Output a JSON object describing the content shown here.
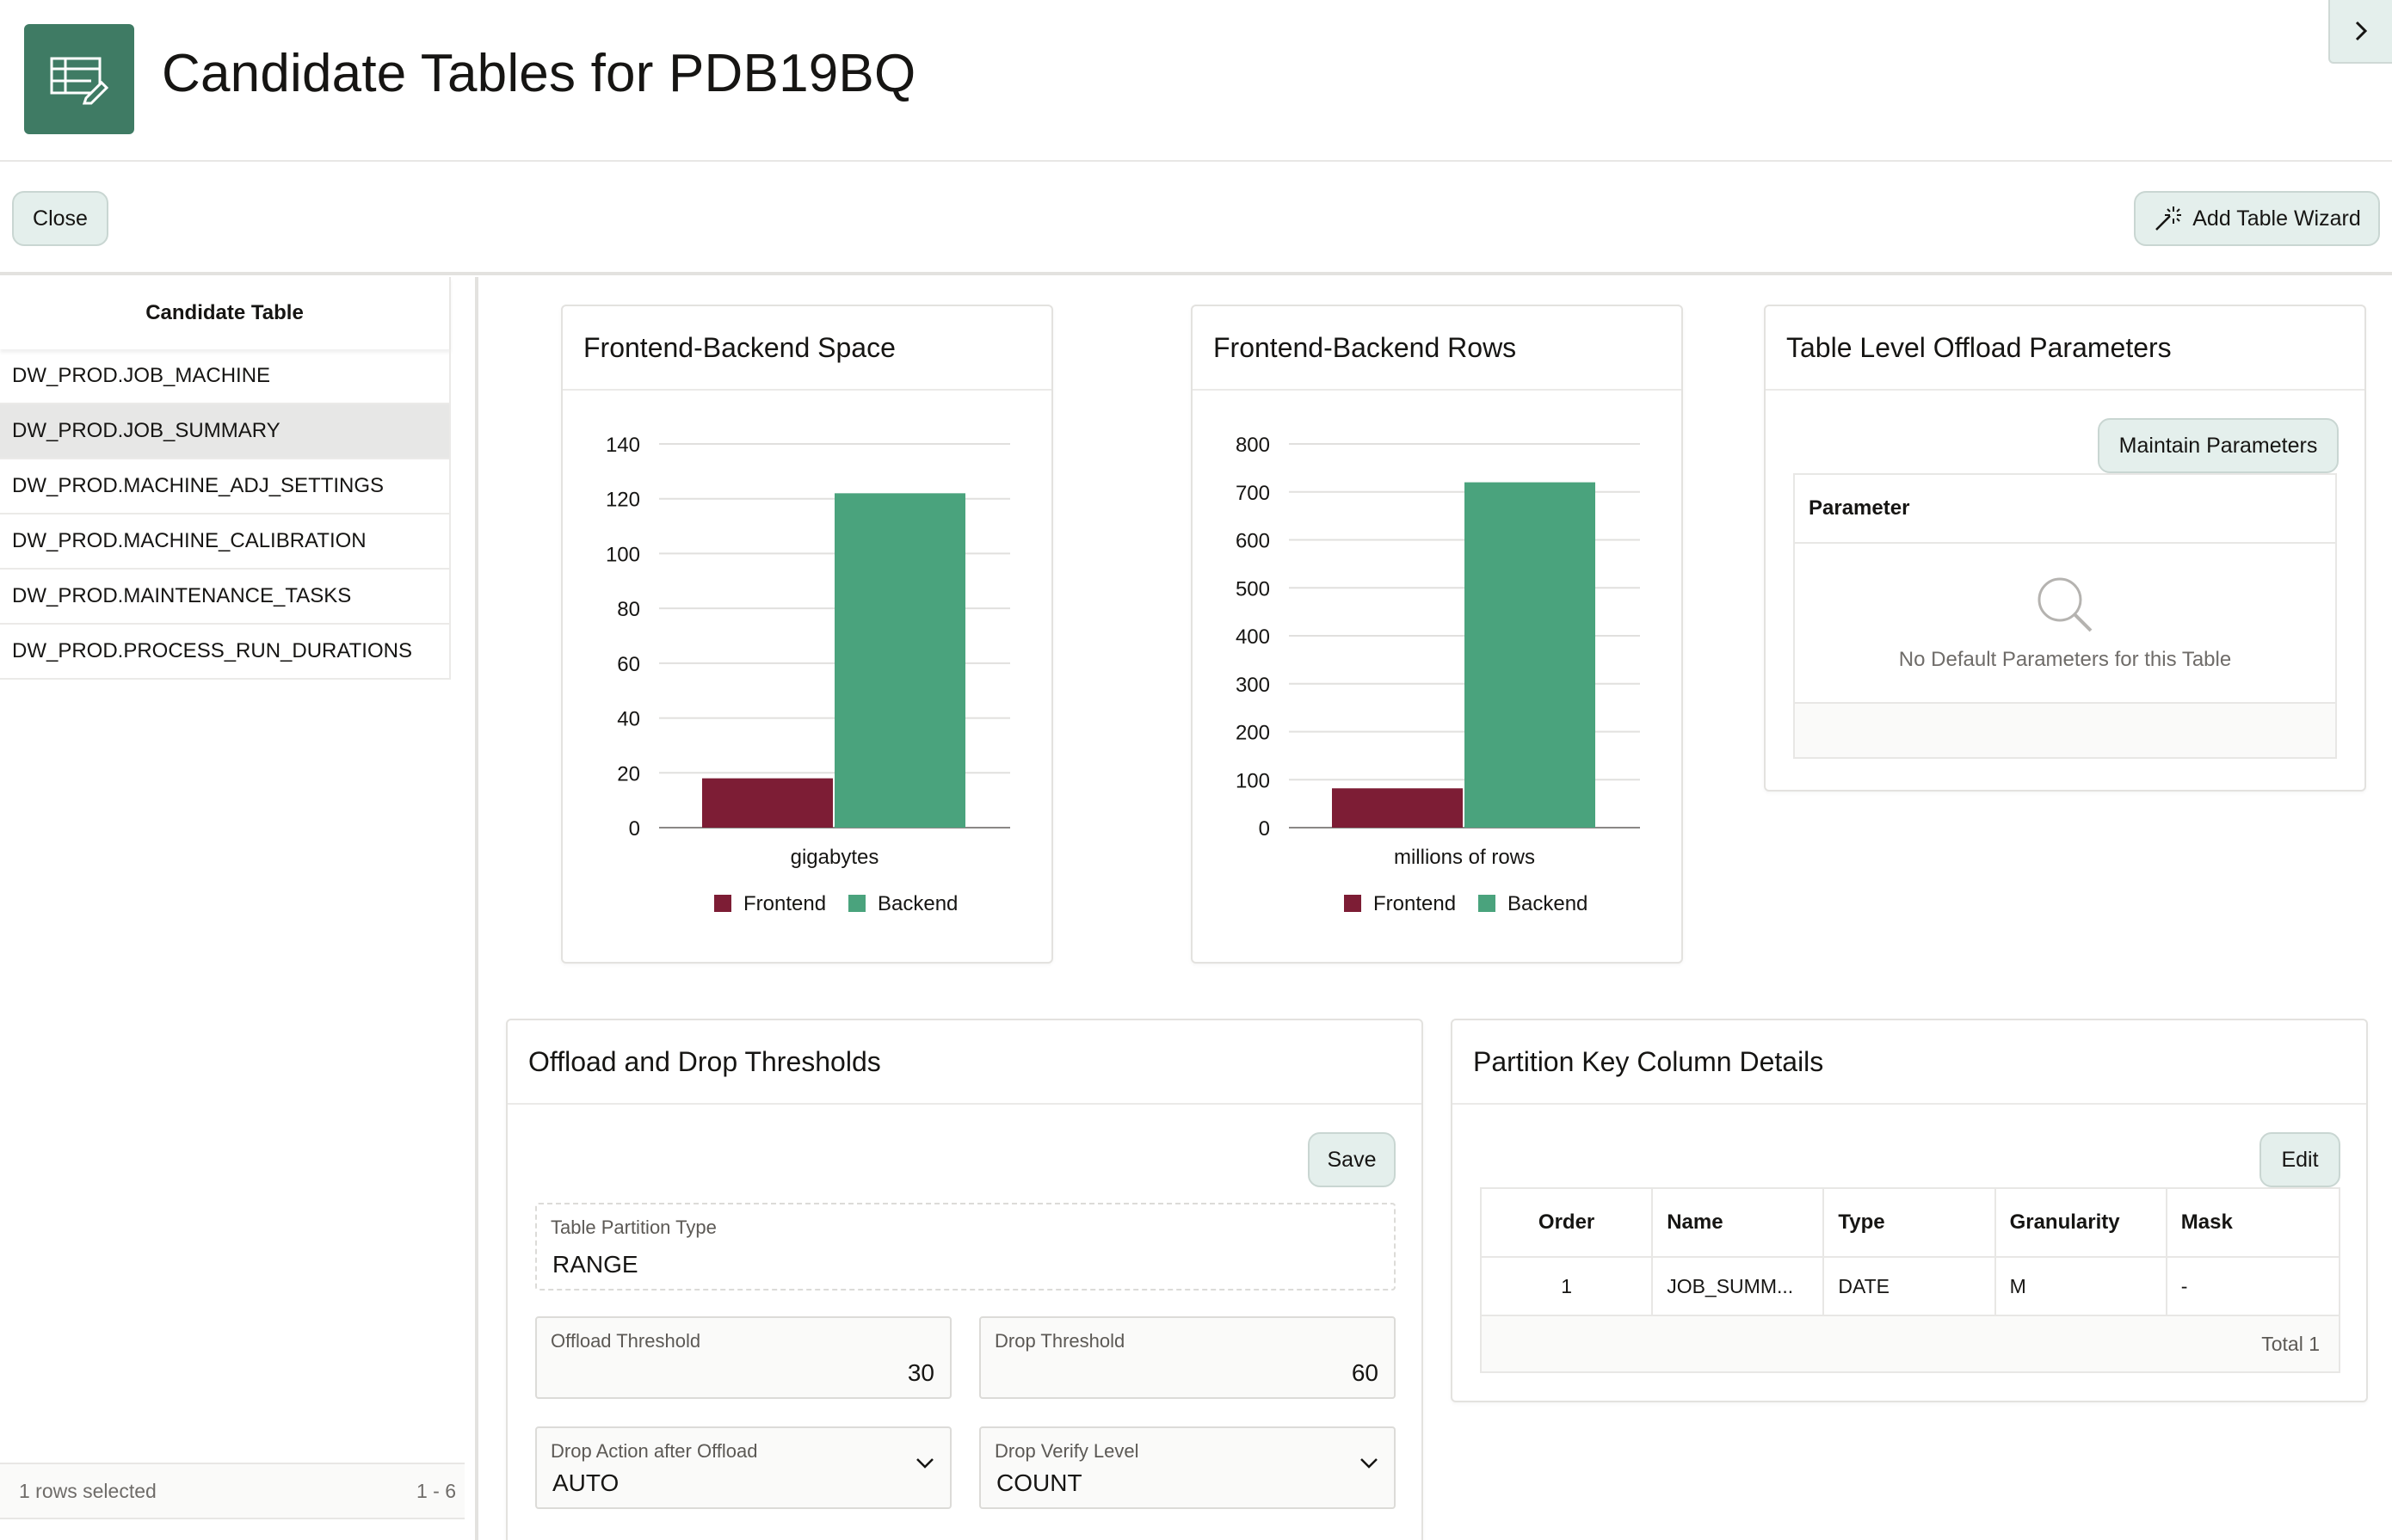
{
  "header": {
    "title": "Candidate Tables for PDB19BQ",
    "icon": "table-edit-icon",
    "collapse_icon": "chevron-right-icon"
  },
  "toolbar": {
    "close_label": "Close",
    "wizard_label": "Add Table Wizard",
    "wizard_icon": "magic-wand-icon"
  },
  "candidate_tables": {
    "header": "Candidate Table",
    "rows": [
      "DW_PROD.JOB_MACHINE",
      "DW_PROD.JOB_SUMMARY",
      "DW_PROD.MACHINE_ADJ_SETTINGS",
      "DW_PROD.MACHINE_CALIBRATION",
      "DW_PROD.MAINTENANCE_TASKS",
      "DW_PROD.PROCESS_RUN_DURATIONS"
    ],
    "selected_index": 1,
    "footer_selected": "1 rows selected",
    "footer_range": "1 - 6"
  },
  "space_card": {
    "title": "Frontend-Backend Space"
  },
  "rows_card": {
    "title": "Frontend-Backend Rows"
  },
  "params_card": {
    "title": "Table Level Offload Parameters",
    "button": "Maintain Parameters",
    "column": "Parameter",
    "empty_text": "No Default Parameters for this Table",
    "empty_icon": "search-icon"
  },
  "thresholds_card": {
    "title": "Offload and Drop Thresholds",
    "save_label": "Save",
    "partition_type_label": "Table Partition Type",
    "partition_type_value": "RANGE",
    "offload_threshold_label": "Offload Threshold",
    "offload_threshold_value": "30",
    "drop_threshold_label": "Drop Threshold",
    "drop_threshold_value": "60",
    "drop_action_label": "Drop Action after Offload",
    "drop_action_value": "AUTO",
    "drop_verify_label": "Drop Verify Level",
    "drop_verify_value": "COUNT"
  },
  "partition_card": {
    "title": "Partition Key Column Details",
    "edit_label": "Edit",
    "columns": [
      "Order",
      "Name",
      "Type",
      "Granularity",
      "Mask"
    ],
    "rows": [
      [
        "1",
        "JOB_SUMM...",
        "DATE",
        "M",
        "-"
      ]
    ],
    "footer": "Total 1"
  },
  "colors": {
    "frontend": "#7d1d35",
    "backend": "#4aa37d",
    "accent": "#3f7b64"
  },
  "chart_data": [
    {
      "type": "bar",
      "title": "Frontend-Backend Space",
      "categories": [
        "gigabytes"
      ],
      "series": [
        {
          "name": "Frontend",
          "values": [
            18
          ]
        },
        {
          "name": "Backend",
          "values": [
            122
          ]
        }
      ],
      "ylim": [
        0,
        140
      ],
      "yticks": [
        0,
        20,
        40,
        60,
        80,
        100,
        120,
        140
      ],
      "grid": true,
      "legend": "bottom"
    },
    {
      "type": "bar",
      "title": "Frontend-Backend Rows",
      "categories": [
        "millions of rows"
      ],
      "series": [
        {
          "name": "Frontend",
          "values": [
            82
          ]
        },
        {
          "name": "Backend",
          "values": [
            720
          ]
        }
      ],
      "ylim": [
        0,
        800
      ],
      "yticks": [
        0,
        100,
        200,
        300,
        400,
        500,
        600,
        700,
        800
      ],
      "grid": true,
      "legend": "bottom"
    }
  ]
}
